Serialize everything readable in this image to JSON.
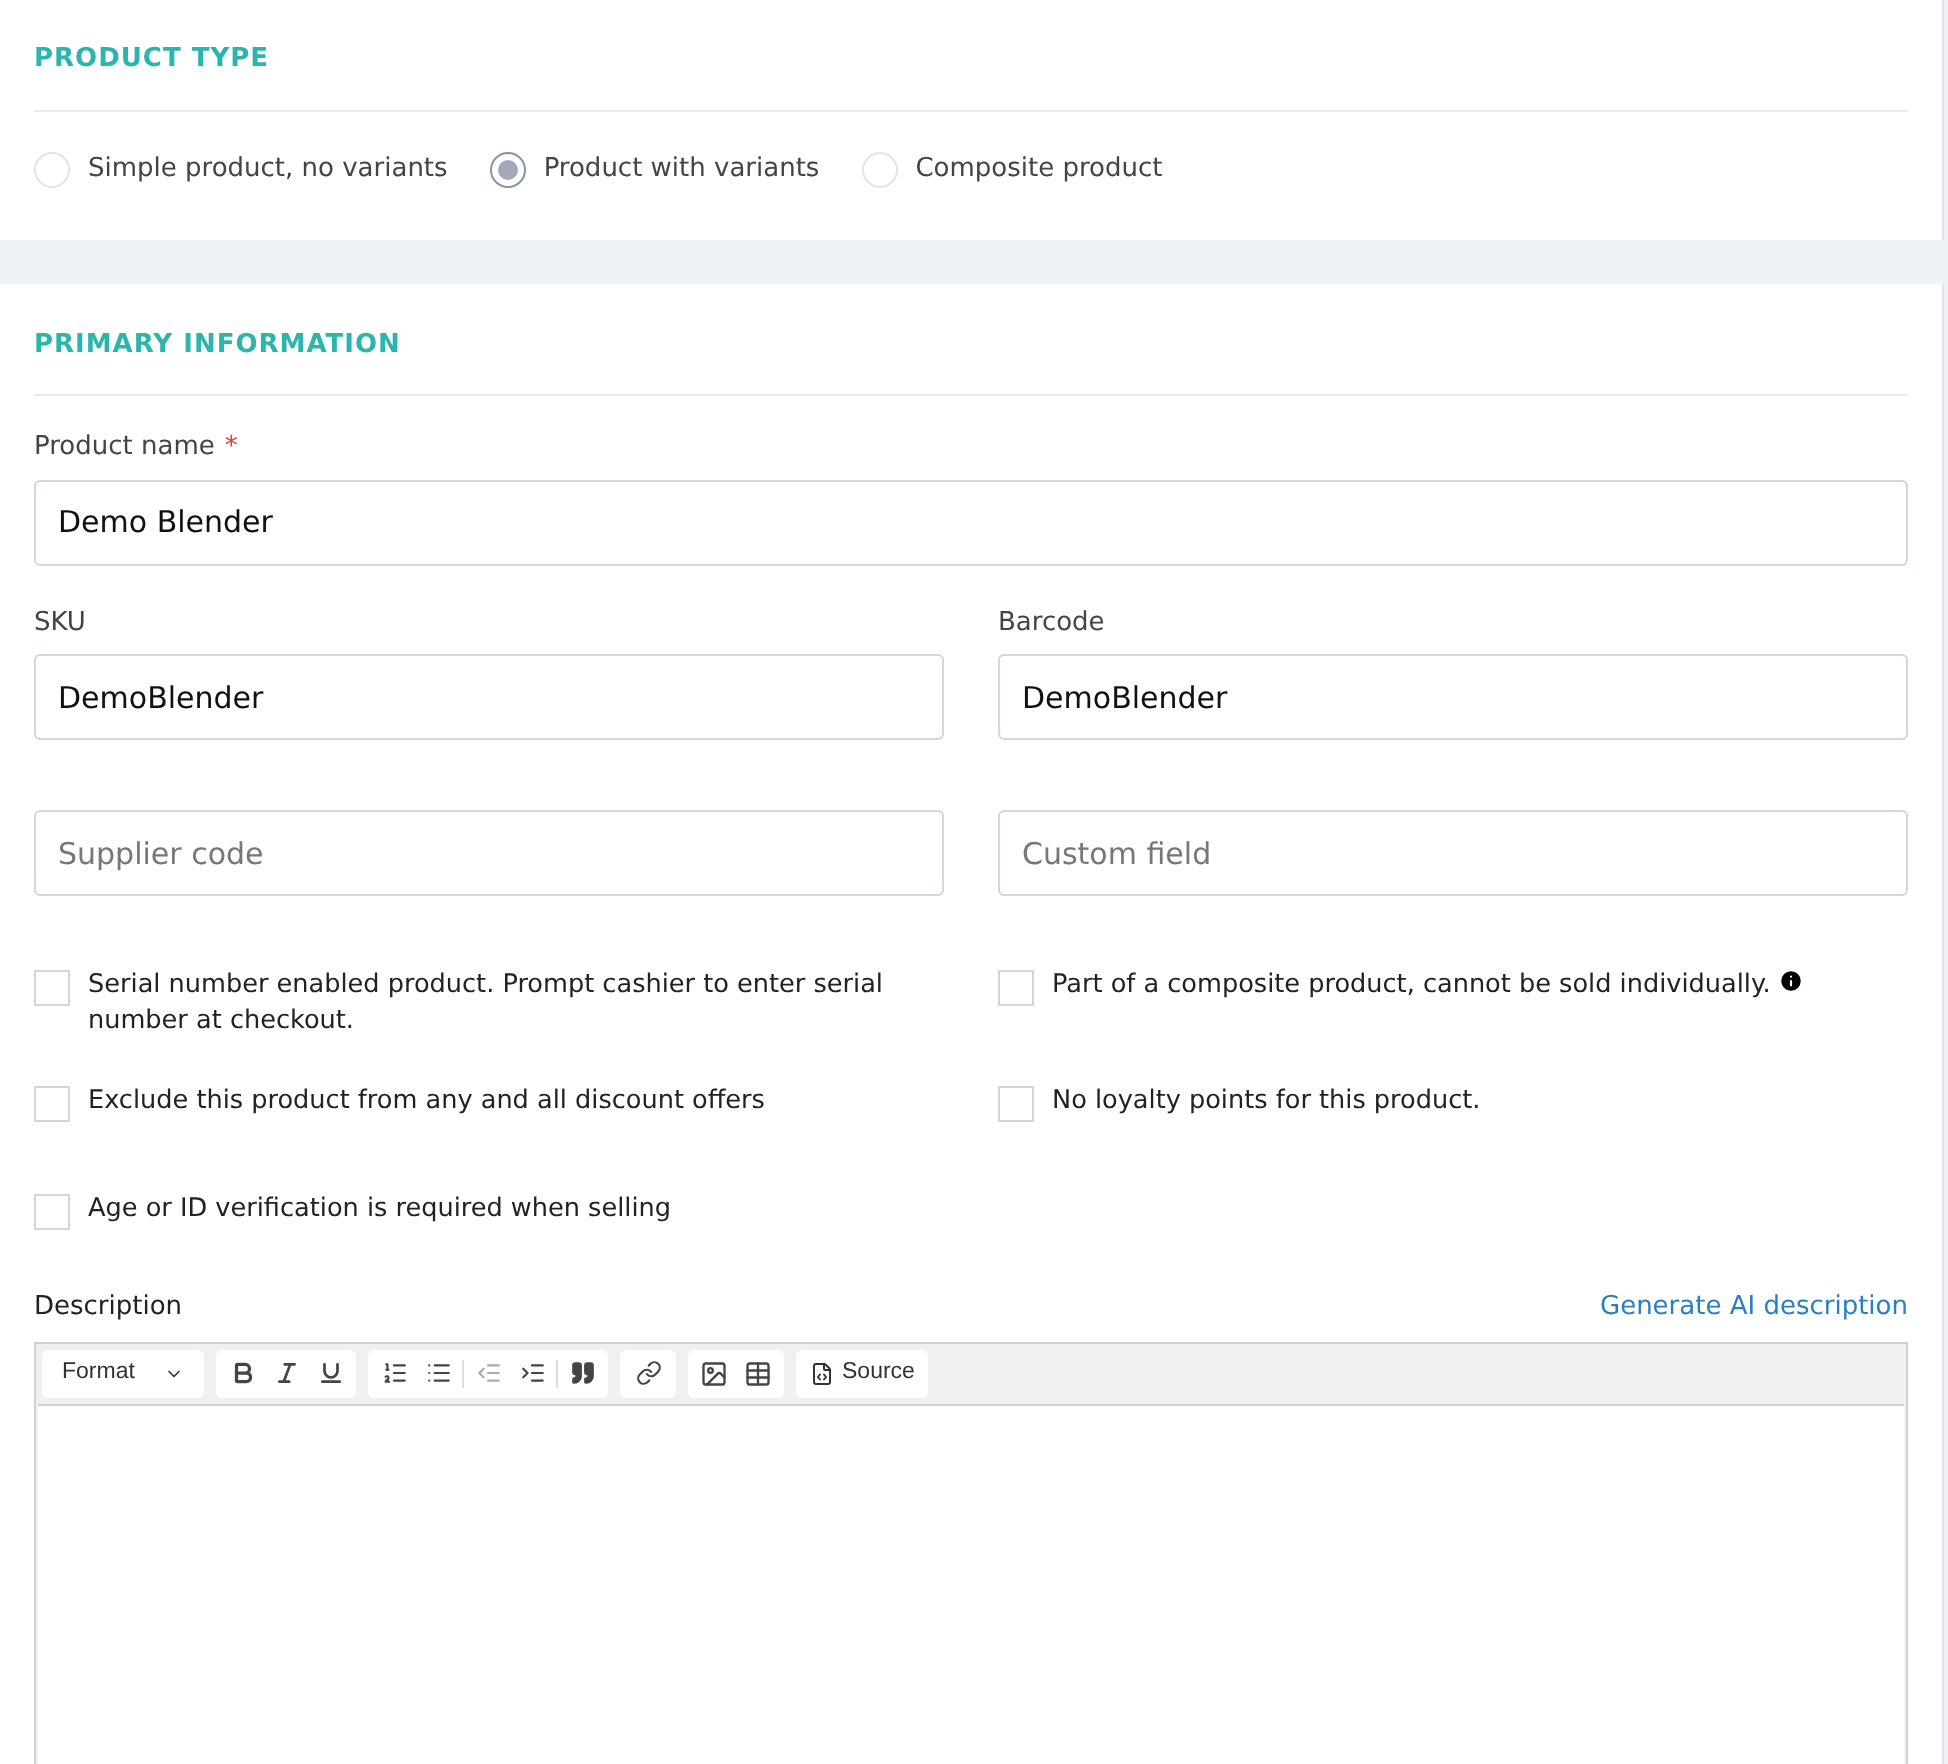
{
  "product_type": {
    "title": "PRODUCT TYPE",
    "options": [
      {
        "label": "Simple product, no variants",
        "selected": false
      },
      {
        "label": "Product with variants",
        "selected": true
      },
      {
        "label": "Composite product",
        "selected": false
      }
    ]
  },
  "primary": {
    "title": "PRIMARY INFORMATION",
    "product_name": {
      "label": "Product name",
      "required_mark": "*",
      "value": "Demo Blender"
    },
    "sku": {
      "label": "SKU",
      "value": "DemoBlender"
    },
    "barcode": {
      "label": "Barcode",
      "value": "DemoBlender"
    },
    "supplier_code": {
      "placeholder": "Supplier code"
    },
    "custom_field": {
      "placeholder": "Custom field"
    },
    "checkboxes": [
      {
        "label": "Serial number enabled product. Prompt cashier to enter serial number at checkout.",
        "checked": false,
        "info": false
      },
      {
        "label": "Part of a composite product, cannot be sold individually.",
        "checked": false,
        "info": true
      },
      {
        "label": "Exclude this product from any and all discount offers",
        "checked": false,
        "info": false
      },
      {
        "label": "No loyalty points for this product.",
        "checked": false,
        "info": false
      },
      {
        "label": "Age or ID verification is required when selling",
        "checked": false,
        "info": false
      }
    ],
    "description": {
      "label": "Description",
      "ai_link": "Generate AI description",
      "format": "Format",
      "source": "Source"
    }
  }
}
